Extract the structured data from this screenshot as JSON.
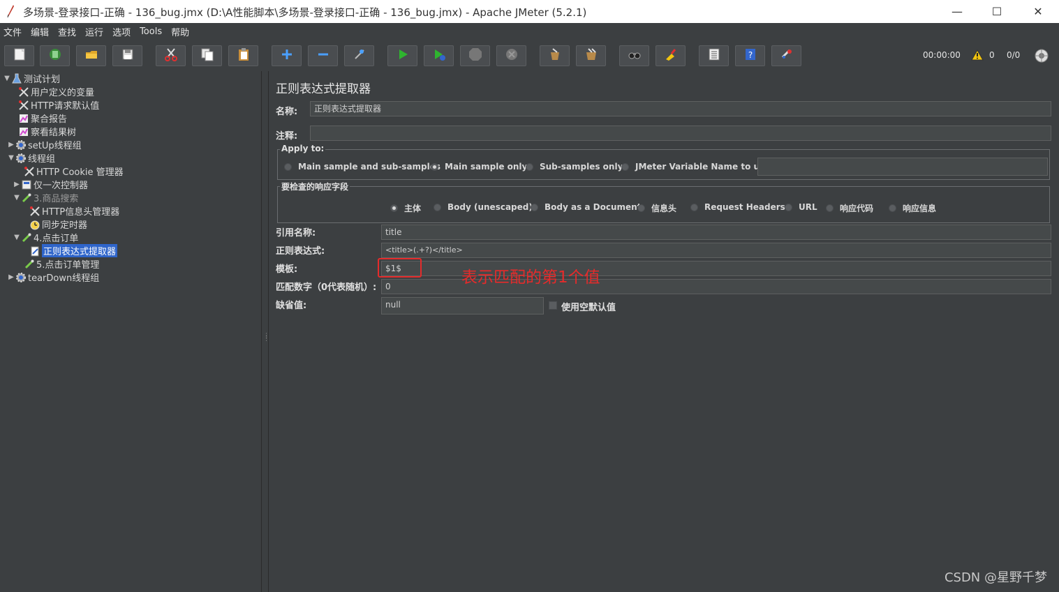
{
  "window": {
    "title": "多场景-登录接口-正确 - 136_bug.jmx (D:\\A性能脚本\\多场景-登录接口-正确 - 136_bug.jmx) - Apache JMeter (5.2.1)",
    "minimize_glyph": "—",
    "maximize_glyph": "☐",
    "close_glyph": "✕"
  },
  "menu": [
    "文件",
    "编辑",
    "查找",
    "运行",
    "选项",
    "Tools",
    "帮助"
  ],
  "toolbar": {
    "buttons": [
      "new-icon",
      "templates-icon",
      "open-icon",
      "save-icon",
      "cut-icon",
      "copy-icon",
      "paste-icon",
      "expand-icon",
      "collapse-icon",
      "toggle-icon",
      "start-icon",
      "start-no-pause-icon",
      "stop-icon",
      "shutdown-icon",
      "clear-icon",
      "clear-all-icon",
      "search-icon",
      "reset-search-icon",
      "function-helper-icon",
      "help-icon",
      "remote-icon"
    ],
    "timer": "00:00:00",
    "warning_count": "0",
    "threads": "0/0"
  },
  "tree": [
    {
      "label": "测试计划",
      "icon": "flask-icon",
      "toggle": "▼",
      "selected": false
    },
    {
      "label": "用户定义的变量",
      "icon": "wrench-icon",
      "toggle": "",
      "selected": false
    },
    {
      "label": "HTTP请求默认值",
      "icon": "wrench-icon",
      "toggle": "",
      "selected": false
    },
    {
      "label": "聚合报告",
      "icon": "chart-icon",
      "toggle": "",
      "selected": false
    },
    {
      "label": "察看结果树",
      "icon": "chart-icon",
      "toggle": "",
      "selected": false
    },
    {
      "label": "setUp线程组",
      "icon": "gear-icon",
      "toggle": "▶",
      "selected": false
    },
    {
      "label": "线程组",
      "icon": "gear-icon",
      "toggle": "▼",
      "selected": false
    },
    {
      "label": "HTTP Cookie 管理器",
      "icon": "wrench-icon",
      "toggle": "",
      "selected": false
    },
    {
      "label": "仅一次控制器",
      "icon": "controller-icon",
      "toggle": "▶",
      "selected": false
    },
    {
      "label": "3.商品搜索",
      "icon": "pipette-icon",
      "toggle": "▼",
      "selected": false,
      "disabled": true
    },
    {
      "label": "HTTP信息头管理器",
      "icon": "wrench-icon",
      "toggle": "",
      "selected": false
    },
    {
      "label": "同步定时器",
      "icon": "timer-icon",
      "toggle": "",
      "selected": false
    },
    {
      "label": "4.点击订单",
      "icon": "pipette-icon",
      "toggle": "▼",
      "selected": false
    },
    {
      "label": "正则表达式提取器",
      "icon": "extractor-icon",
      "toggle": "",
      "selected": true
    },
    {
      "label": "5.点击订单管理",
      "icon": "pipette-icon",
      "toggle": "",
      "selected": false
    },
    {
      "label": "tearDown线程组",
      "icon": "gear-icon",
      "toggle": "▶",
      "selected": false
    }
  ],
  "panel": {
    "title": "正则表达式提取器",
    "name_label": "名称:",
    "name_value": "正则表达式提取器",
    "comment_label": "注释:",
    "comment_value": "",
    "apply_to": {
      "title": "Apply to:",
      "options": [
        {
          "label": "Main sample and sub-samples",
          "checked": false
        },
        {
          "label": "Main sample only",
          "checked": true
        },
        {
          "label": "Sub-samples only",
          "checked": false
        },
        {
          "label": "JMeter Variable Name to use",
          "checked": false
        }
      ],
      "variable_value": ""
    },
    "field_to_check": {
      "title": "要检查的响应字段",
      "options": [
        {
          "label": "主体",
          "checked": true
        },
        {
          "label": "Body (unescaped)",
          "checked": false
        },
        {
          "label": "Body as a Document",
          "checked": false
        },
        {
          "label": "信息头",
          "checked": false
        },
        {
          "label": "Request Headers",
          "checked": false
        },
        {
          "label": "URL",
          "checked": false
        },
        {
          "label": "响应代码",
          "checked": false
        },
        {
          "label": "响应信息",
          "checked": false
        }
      ]
    },
    "ref_name_label": "引用名称:",
    "ref_name_value": "title",
    "regex_label": "正则表达式:",
    "regex_value": "<title>(.+?)</title>",
    "template_label": "模板:",
    "template_value": "$1$",
    "match_no_label": "匹配数字（0代表随机）:",
    "match_no_value": "0",
    "default_label": "缺省值:",
    "default_value": "null",
    "use_empty_default_label": "使用空默认值",
    "use_empty_default_checked": false
  },
  "annotation": {
    "text": "表示匹配的第1个值",
    "color": "#e52b2b"
  },
  "watermark": "CSDN @星野千梦"
}
